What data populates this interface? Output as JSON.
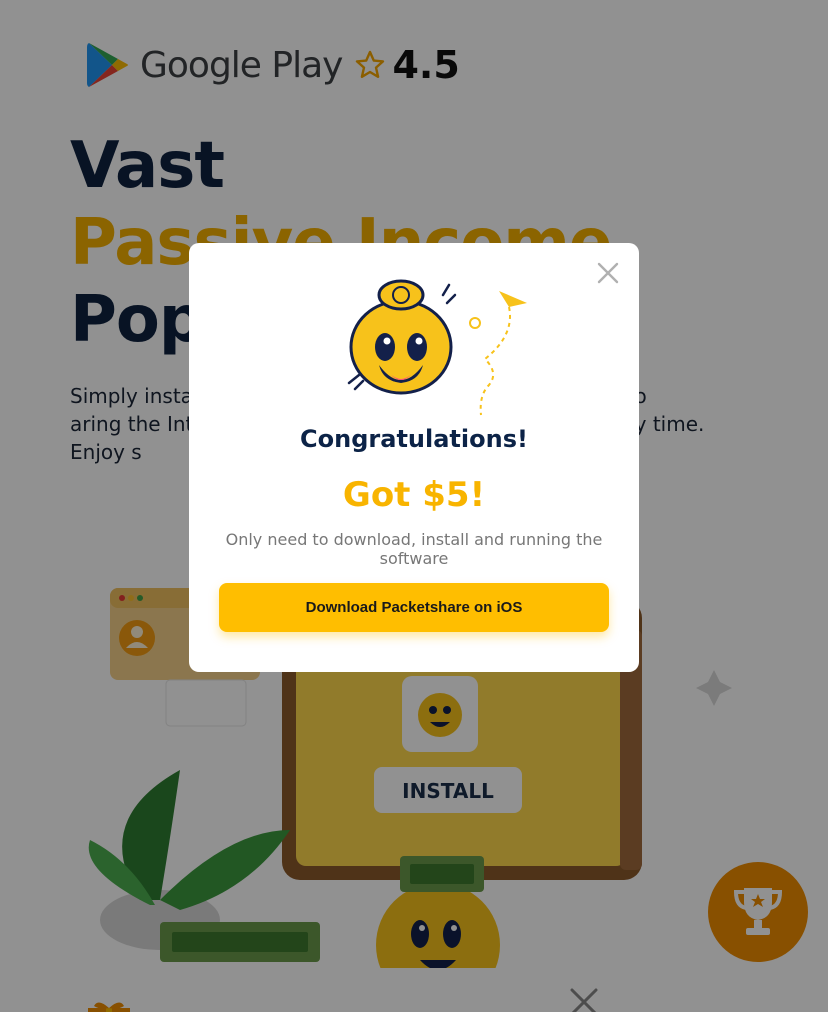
{
  "store": {
    "name": "Google Play",
    "rating": "4.5",
    "icons": {
      "logo": "google-play-icon",
      "star": "star-outline-icon"
    }
  },
  "hero": {
    "line1": "Vast",
    "line2": "Passive Income",
    "line3": "Pop",
    "description": "Simply insta                                                an account, no                                                      aring the Internet                                                  h at any time. Enjoy s"
  },
  "illustration": {
    "install_label": "INSTALL"
  },
  "floating": {
    "trophy_icon": "trophy-icon"
  },
  "bottom_panel": {
    "gift_icon": "gift-icon",
    "close_icon": "close-icon"
  },
  "modal": {
    "title": "Congratulations!",
    "amount": "Got $5!",
    "subtitle": "Only need to download, install and running the software",
    "button": "Download Packetshare on iOS",
    "close_icon": "close-icon"
  },
  "colors": {
    "brand_yellow": "#ffbe00",
    "navy": "#0c2347",
    "amount_yellow": "#f8b400",
    "trophy_orange": "#f08d00",
    "overlay": "rgba(0,0,0,0.43)"
  }
}
